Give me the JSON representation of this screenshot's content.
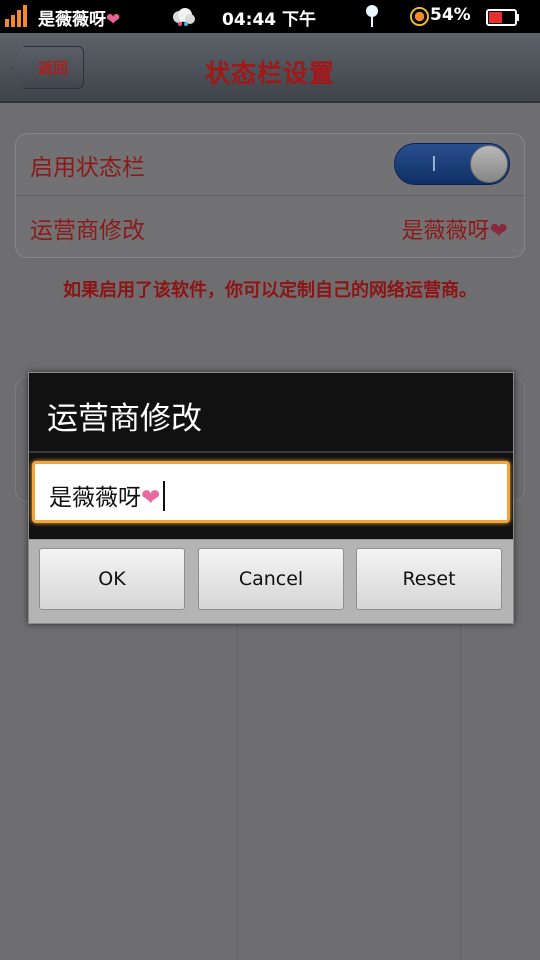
{
  "status_bar": {
    "carrier": "是薇薇呀",
    "carrier_heart": "❤",
    "time": "04:44 下午",
    "battery_percent": "54%",
    "icons": [
      "signal-icon",
      "weather-icon",
      "location-icon",
      "battery-indicator-icon",
      "battery-icon"
    ]
  },
  "title_bar": {
    "back_label": "返回",
    "title": "状态栏设置"
  },
  "settings": {
    "rows": [
      {
        "label": "启用状态栏",
        "toggle_on": true,
        "toggle_mark": "I"
      },
      {
        "label": "运营商修改",
        "value": "是薇薇呀",
        "value_heart": "❤"
      }
    ],
    "hint": "如果启用了该软件，你可以定制自己的网络运营商。"
  },
  "dialog": {
    "title": "运营商修改",
    "input_value": "是薇薇呀",
    "input_heart": "❤",
    "buttons": {
      "ok": "OK",
      "cancel": "Cancel",
      "reset": "Reset"
    }
  },
  "colors": {
    "accent_red": "#8c1a1a",
    "toggle_blue": "#1f4585",
    "input_focus": "#f0a63a",
    "heart_pink": "#e7649a"
  }
}
